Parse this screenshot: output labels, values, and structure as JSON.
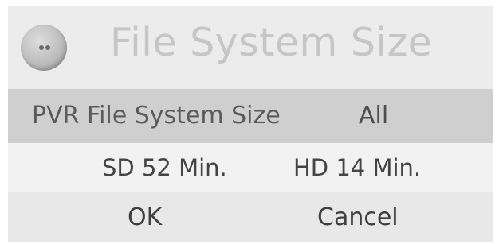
{
  "dialog": {
    "title": "File System Size",
    "icon": "disc-icon"
  },
  "pvr": {
    "label": "PVR File System Size",
    "value": "All"
  },
  "capacity": {
    "sd": "SD 52 Min.",
    "hd": "HD 14 Min."
  },
  "buttons": {
    "ok": "OK",
    "cancel": "Cancel"
  }
}
